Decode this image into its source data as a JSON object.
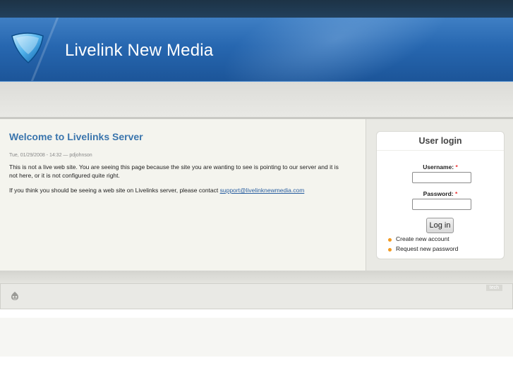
{
  "site": {
    "name": "Livelink New Media"
  },
  "content": {
    "title": "Welcome to Livelinks Server",
    "submitted": "Tue, 01/29/2008 - 14:32 — pdjohnson",
    "paragraph1": "This is not a live web site. You are seeing this page because the site you are wanting to see is pointing to our server and it is not here, or it is not configured quite right.",
    "paragraph2_prefix": "If you think you should be seeing a web site on Livelinks server, please contact ",
    "contact_email": "support@livelinknewmedia.com"
  },
  "login": {
    "title": "User login",
    "username_label": "Username:",
    "password_label": "Password:",
    "required_marker": "*",
    "username_value": "",
    "password_value": "",
    "submit_label": "Log in",
    "links": [
      "Create new account",
      "Request new password"
    ]
  },
  "footer": {
    "tag": "tech",
    "icon": "drupal-icon"
  },
  "colors": {
    "header_blue": "#2767b0",
    "title_blue": "#3a75ad",
    "bullet_orange": "#f29a22",
    "required_red": "#ee3333"
  }
}
